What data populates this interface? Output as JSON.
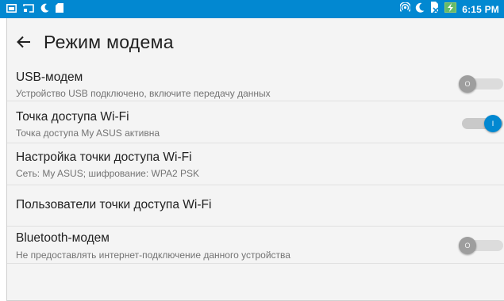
{
  "status_bar": {
    "time": "6:15 PM",
    "color": "#0288d1",
    "left_icons": [
      "gallery-icon",
      "cast-icon",
      "moon-icon",
      "sd-card-icon"
    ],
    "right_icons": [
      "hotspot-icon",
      "moon-icon",
      "sim-no-signal-icon",
      "battery-charging-icon"
    ]
  },
  "app_bar": {
    "title": "Режим модема",
    "back_icon": "back-arrow-icon"
  },
  "settings": [
    {
      "id": "usb",
      "title": "USB-модем",
      "subtitle": "Устройство USB подключено, включите передачу данных",
      "switch": "off",
      "switch_label": "O"
    },
    {
      "id": "wifi-hotspot",
      "title": "Точка доступа Wi-Fi",
      "subtitle": "Точка доступа My ASUS активна",
      "switch": "on",
      "switch_label": "I"
    },
    {
      "id": "wifi-setup",
      "title": "Настройка точки доступа Wi-Fi",
      "subtitle": "Сеть: My ASUS; шифрование: WPA2 PSK"
    },
    {
      "id": "wifi-users",
      "title": "Пользователи точки доступа Wi-Fi"
    },
    {
      "id": "bluetooth",
      "title": "Bluetooth-модем",
      "subtitle": "Не предоставлять интернет-подключение данного устройства",
      "switch": "off",
      "switch_label": "O"
    }
  ],
  "colors": {
    "accent": "#0288d1",
    "background": "#f4f4f4",
    "primary_text": "#212121",
    "secondary_text": "#737373"
  }
}
